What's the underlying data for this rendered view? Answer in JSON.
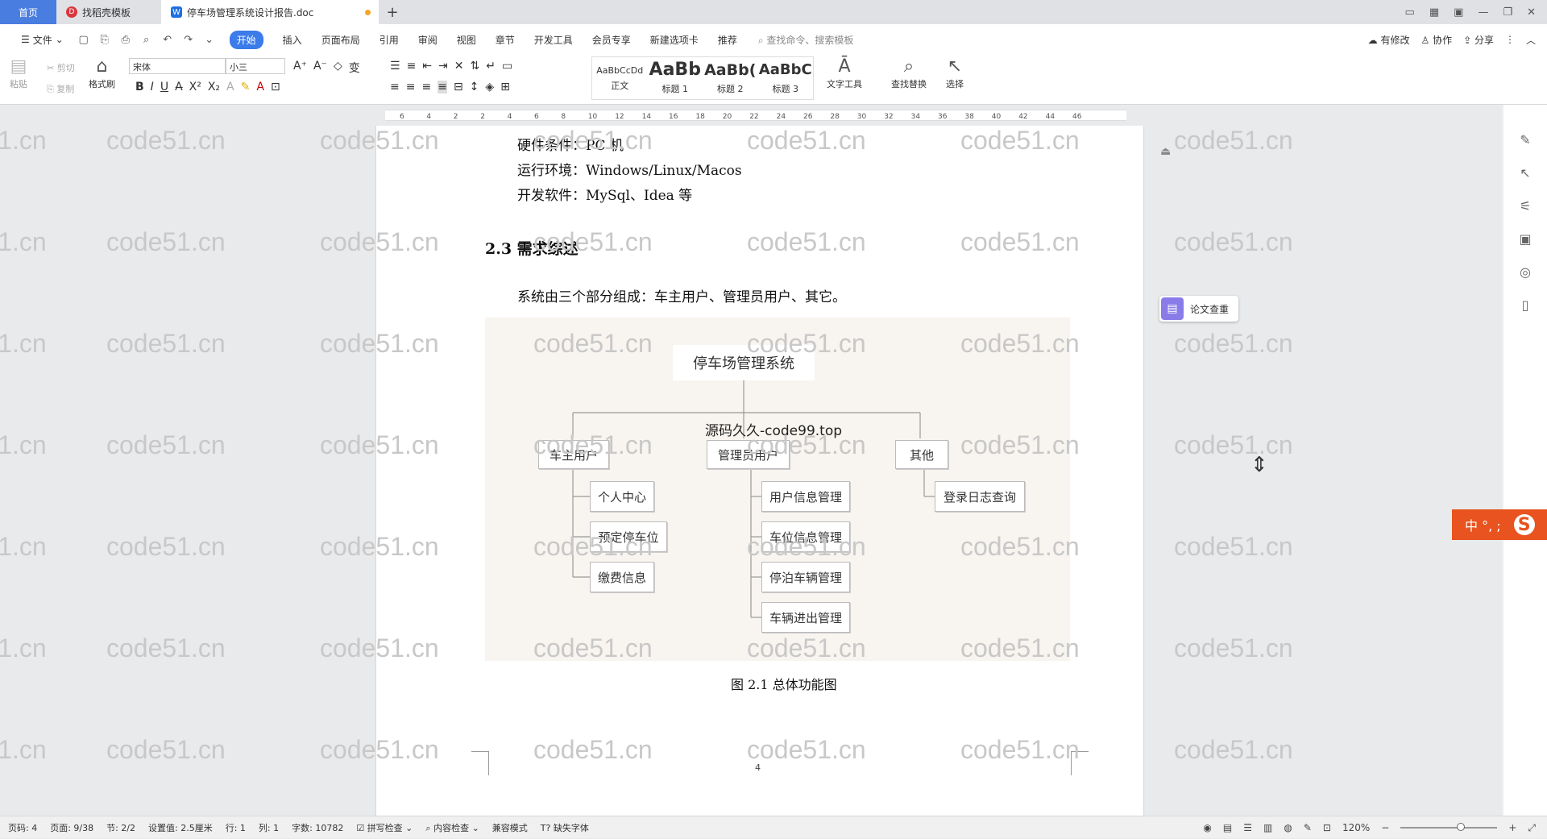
{
  "tabs": {
    "home": "首页",
    "template": "找稻壳模板",
    "doc": "停车场管理系统设计报告.doc",
    "new": "+"
  },
  "menu": {
    "file": "文件",
    "items": [
      "开始",
      "插入",
      "页面布局",
      "引用",
      "审阅",
      "视图",
      "章节",
      "开发工具",
      "会员专享",
      "新建选项卡",
      "推荐"
    ],
    "search_placeholder": "查找命令、搜索模板",
    "has_changes": "有修改",
    "collab": "协作",
    "share": "分享"
  },
  "ribbon": {
    "paste": "粘贴",
    "cut": "剪切",
    "copy": "复制",
    "format_painter": "格式刷",
    "font": "宋体",
    "size": "小三",
    "styles": [
      {
        "sample": "AaBbCcDd",
        "label": "正文"
      },
      {
        "sample": "AaBb",
        "label": "标题 1"
      },
      {
        "sample": "AaBb(",
        "label": "标题 2"
      },
      {
        "sample": "AaBbC",
        "label": "标题 3"
      }
    ],
    "text_tools": "文字工具",
    "find_replace": "查找替换",
    "select": "选择"
  },
  "ruler_ticks": [
    "6",
    "4",
    "2",
    "2",
    "4",
    "6",
    "8",
    "10",
    "12",
    "14",
    "16",
    "18",
    "20",
    "22",
    "24",
    "26",
    "28",
    "30",
    "32",
    "34",
    "36",
    "38",
    "40",
    "42",
    "44",
    "46"
  ],
  "document": {
    "line_hardware": "硬件条件：PC 机",
    "line_env": "运行环境：Windows/Linux/Macos",
    "line_software": "开发软件：MySql、Idea 等",
    "heading": "2.3  需求综述",
    "intro": "系统由三个部分组成：车主用户、管理员用户、其它。",
    "caption": "图 2.1  总体功能图",
    "page_number": "4"
  },
  "diagram": {
    "root": "停车场管理系统",
    "watermark_text": "源码久久-code99.top",
    "groups": [
      {
        "name": "车主用户",
        "children": [
          "个人中心",
          "预定停车位",
          "缴费信息"
        ]
      },
      {
        "name": "管理员用户",
        "children": [
          "用户信息管理",
          "车位信息管理",
          "停泊车辆管理",
          "车辆进出管理"
        ]
      },
      {
        "name": "其他",
        "children": [
          "登录日志查询"
        ]
      }
    ]
  },
  "watermark": "code51.cn",
  "side": {
    "plagiarism_check": "论文查重"
  },
  "ime": {
    "label": "中 °, ;"
  },
  "status": {
    "page_code": "页码: 4",
    "page": "页面: 9/38",
    "section": "节: 2/2",
    "setting": "设置值: 2.5厘米",
    "row": "行: 1",
    "col": "列: 1",
    "words": "字数: 10782",
    "spell": "拼写检查",
    "content_check": "内容检查",
    "compat": "兼容模式",
    "missing_font": "缺失字体",
    "zoom": "120%"
  },
  "colors": {
    "accent": "#3b7bea",
    "diagram_bg": "#f8f4ef",
    "ime": "#e8531f"
  }
}
